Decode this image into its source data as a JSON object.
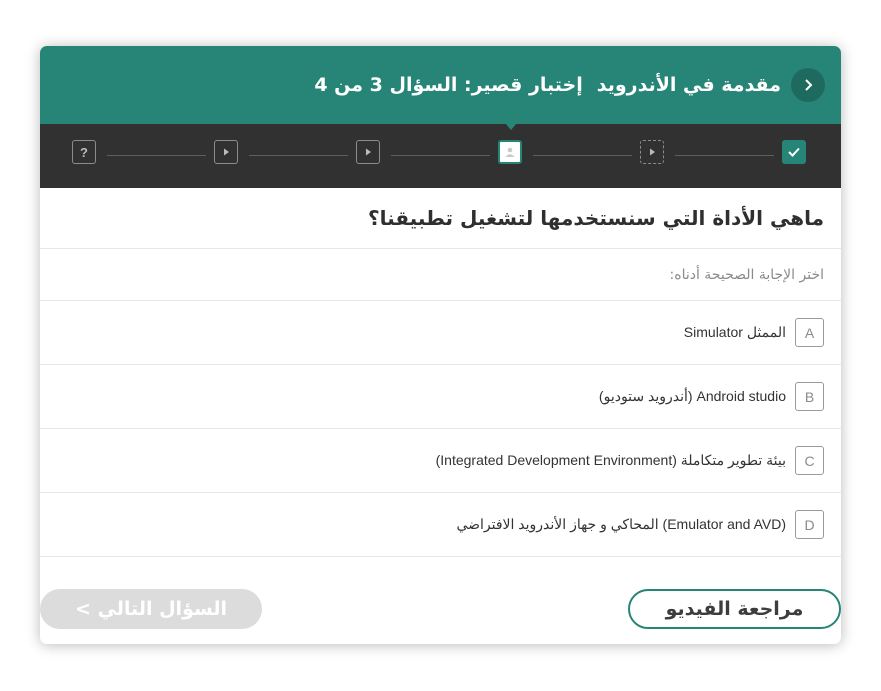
{
  "header": {
    "course_title": "مقدمة في الأندرويد",
    "quiz_title": "إختبار قصير: السؤال 3 من 4",
    "accent_color": "#268577"
  },
  "progress": {
    "steps": [
      {
        "type": "completed",
        "icon": "check-icon"
      },
      {
        "type": "video-dashed",
        "icon": "play-icon"
      },
      {
        "type": "current",
        "icon": "person-icon"
      },
      {
        "type": "video",
        "icon": "play-icon"
      },
      {
        "type": "video",
        "icon": "play-icon"
      },
      {
        "type": "quiz",
        "icon": "question-icon",
        "label": "?"
      }
    ]
  },
  "question": {
    "text": "ماهي الأداة التي سنستخدمها لتشغيل تطبيقنا؟",
    "instruction": "اختر الإجابة الصحيحة أدناه:"
  },
  "options": [
    {
      "letter": "A",
      "text": "الممثل Simulator"
    },
    {
      "letter": "B",
      "text": "Android studio (أندرويد ستوديو)"
    },
    {
      "letter": "C",
      "text": "بيئة تطوير متكاملة (Integrated Development Environment)"
    },
    {
      "letter": "D",
      "text": "(Emulator and AVD) المحاكي و جهاز الأندرويد الافتراضي"
    }
  ],
  "footer": {
    "review_label": "مراجعة الفيديو",
    "next_label": "السؤال التالي >"
  }
}
